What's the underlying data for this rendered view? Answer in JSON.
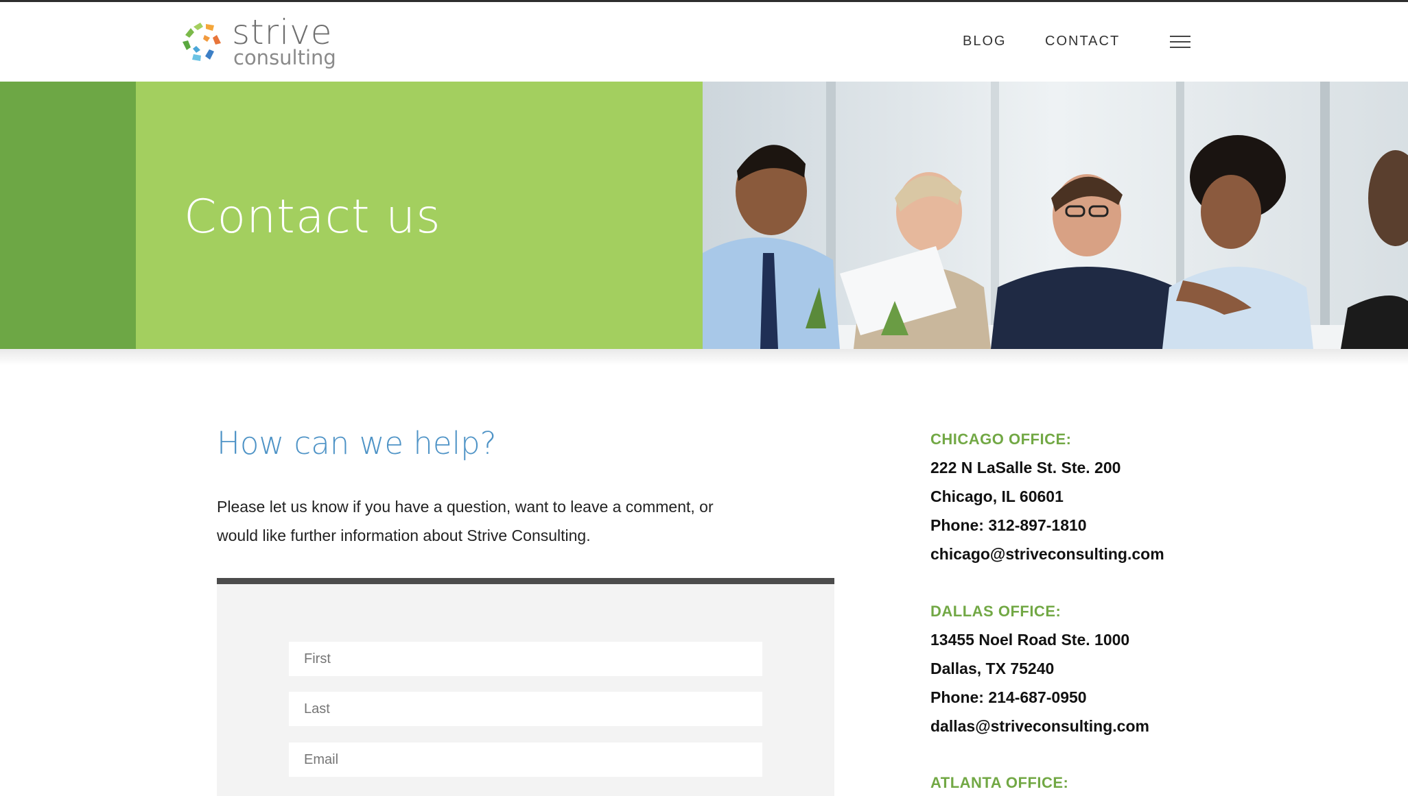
{
  "header": {
    "logo": {
      "word": "strive",
      "sub": "consulting"
    },
    "nav": {
      "blog": "BLOG",
      "contact": "CONTACT",
      "menu_icon": "hamburger-menu-icon"
    }
  },
  "hero": {
    "title": "Contact us",
    "photo": "team-meeting-photo"
  },
  "main": {
    "heading": "How can we help?",
    "intro_line1": "Please let us know if you have a question, want to leave a comment, or",
    "intro_line2": "would like further information about Strive Consulting.",
    "form": {
      "first_placeholder": "First",
      "last_placeholder": "Last",
      "email_placeholder": "Email"
    }
  },
  "offices": {
    "chicago": {
      "title": "CHICAGO OFFICE:",
      "address1": "222 N LaSalle St. Ste. 200",
      "address2": "Chicago, IL 60601",
      "phone": "Phone: 312-897-1810",
      "email": "chicago@striveconsulting.com"
    },
    "dallas": {
      "title": "DALLAS OFFICE:",
      "address1": "13455 Noel Road Ste. 1000",
      "address2": "Dallas, TX 75240",
      "phone": "Phone: 214-687-0950",
      "email": "dallas@striveconsulting.com"
    },
    "atlanta": {
      "title": "ATLANTA OFFICE:"
    }
  },
  "colors": {
    "green_dark": "#6da745",
    "green_light": "#a3cf5f",
    "office_title_green": "#72a845",
    "heading_blue": "#4e93c6",
    "form_border": "#4c4c4c"
  }
}
